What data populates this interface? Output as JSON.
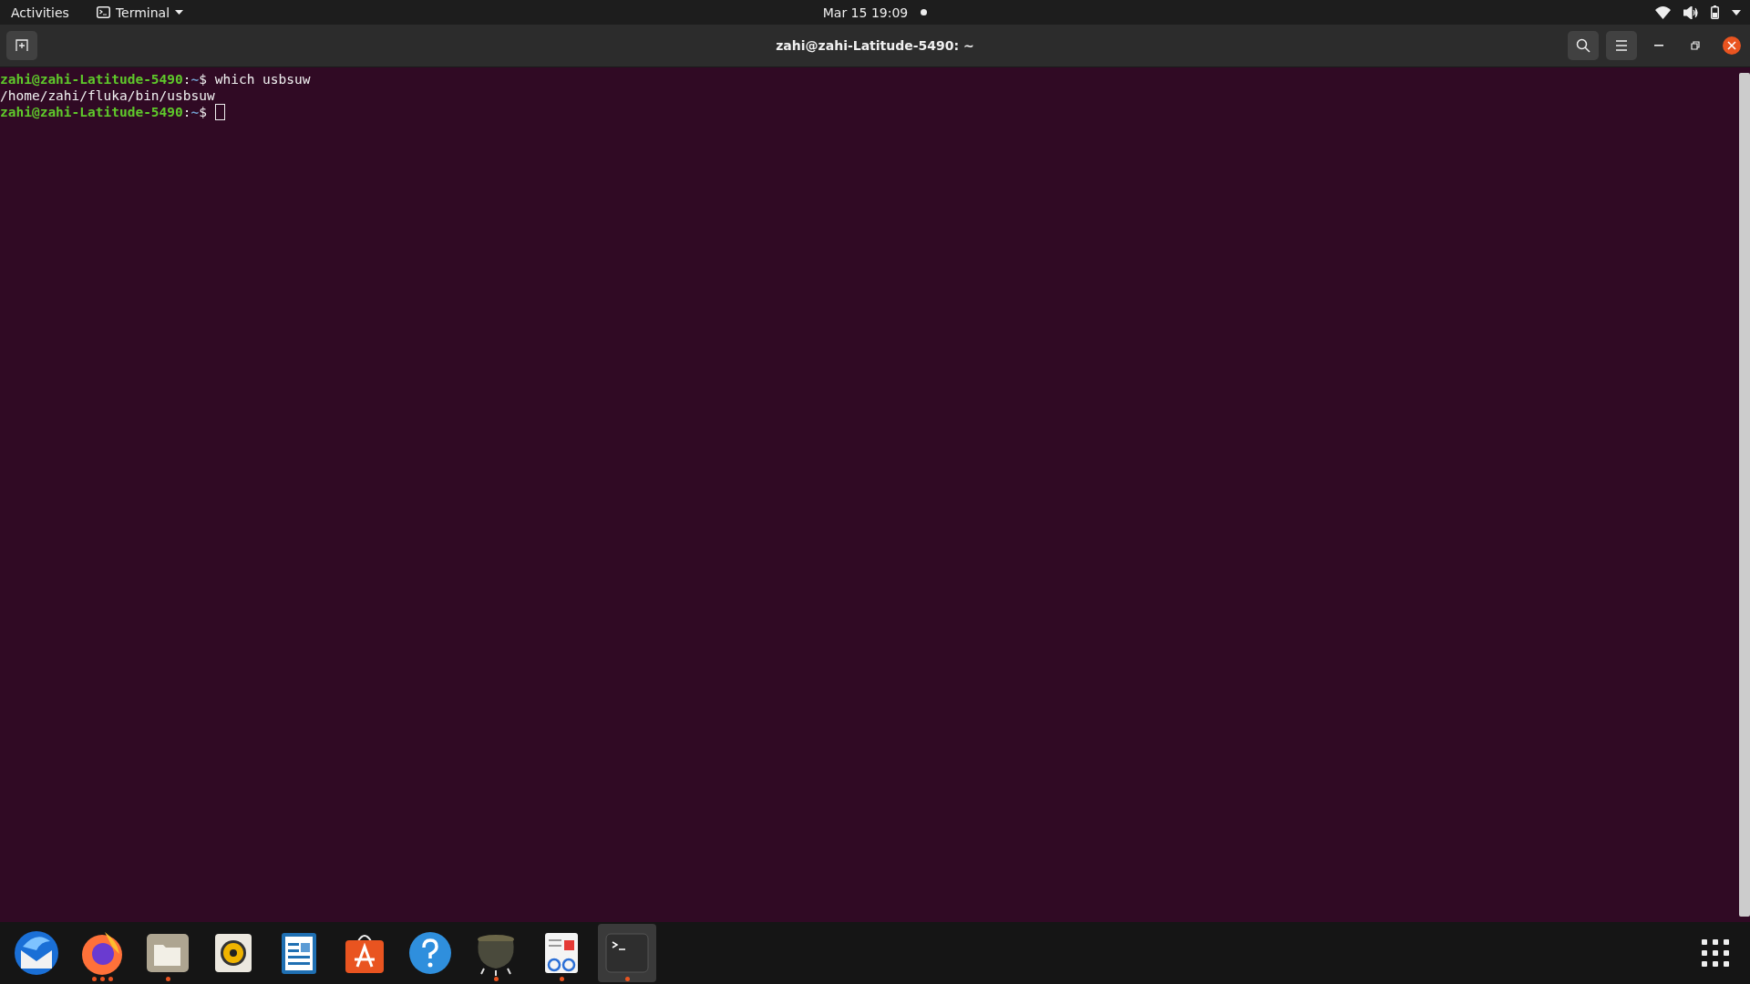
{
  "top_bar": {
    "activities": "Activities",
    "app_menu": "Terminal",
    "clock": "Mar 15  19:09",
    "notification_dot": true
  },
  "window": {
    "title": "zahi@zahi-Latitude-5490: ~"
  },
  "terminal": {
    "lines": [
      {
        "kind": "prompt",
        "user_host": "zahi@zahi-Latitude-5490",
        "separator": ":",
        "path": "~",
        "symbol": "$",
        "command": "which usbsuw",
        "cursor": false
      },
      {
        "kind": "output",
        "text": "/home/zahi/fluka/bin/usbsuw"
      },
      {
        "kind": "prompt",
        "user_host": "zahi@zahi-Latitude-5490",
        "separator": ":",
        "path": "~",
        "symbol": "$",
        "cursor": true
      }
    ]
  },
  "dock": {
    "apps": [
      {
        "kind": "mail",
        "running": false,
        "selected": false
      },
      {
        "kind": "browser",
        "running": true,
        "multiple_windows": true,
        "selected": false
      },
      {
        "kind": "files",
        "running": true,
        "multiple_windows": false,
        "selected": false
      },
      {
        "kind": "music",
        "running": false,
        "selected": false
      },
      {
        "kind": "writer",
        "running": false,
        "selected": false
      },
      {
        "kind": "store",
        "running": false,
        "selected": false
      },
      {
        "kind": "help",
        "running": false,
        "selected": false
      },
      {
        "kind": "cauldron",
        "running": true,
        "multiple_windows": false,
        "selected": false
      },
      {
        "kind": "reader",
        "running": true,
        "multiple_windows": false,
        "selected": false
      },
      {
        "kind": "terminal",
        "running": true,
        "multiple_windows": false,
        "selected": true
      }
    ]
  }
}
